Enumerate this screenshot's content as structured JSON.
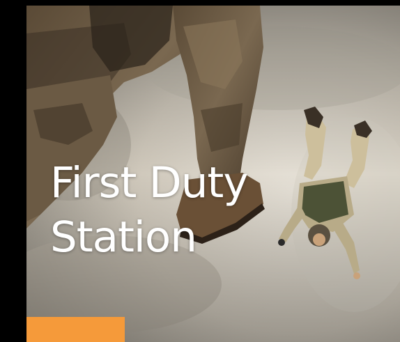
{
  "card": {
    "title_line1": "First Duty",
    "title_line2": "Station"
  },
  "image": {
    "subject": "two paratroopers in desert camouflage free-falling above cloud cover"
  },
  "colors": {
    "accent": "#F59A3A",
    "title": "#FFFFFF",
    "frame": "#000000"
  }
}
